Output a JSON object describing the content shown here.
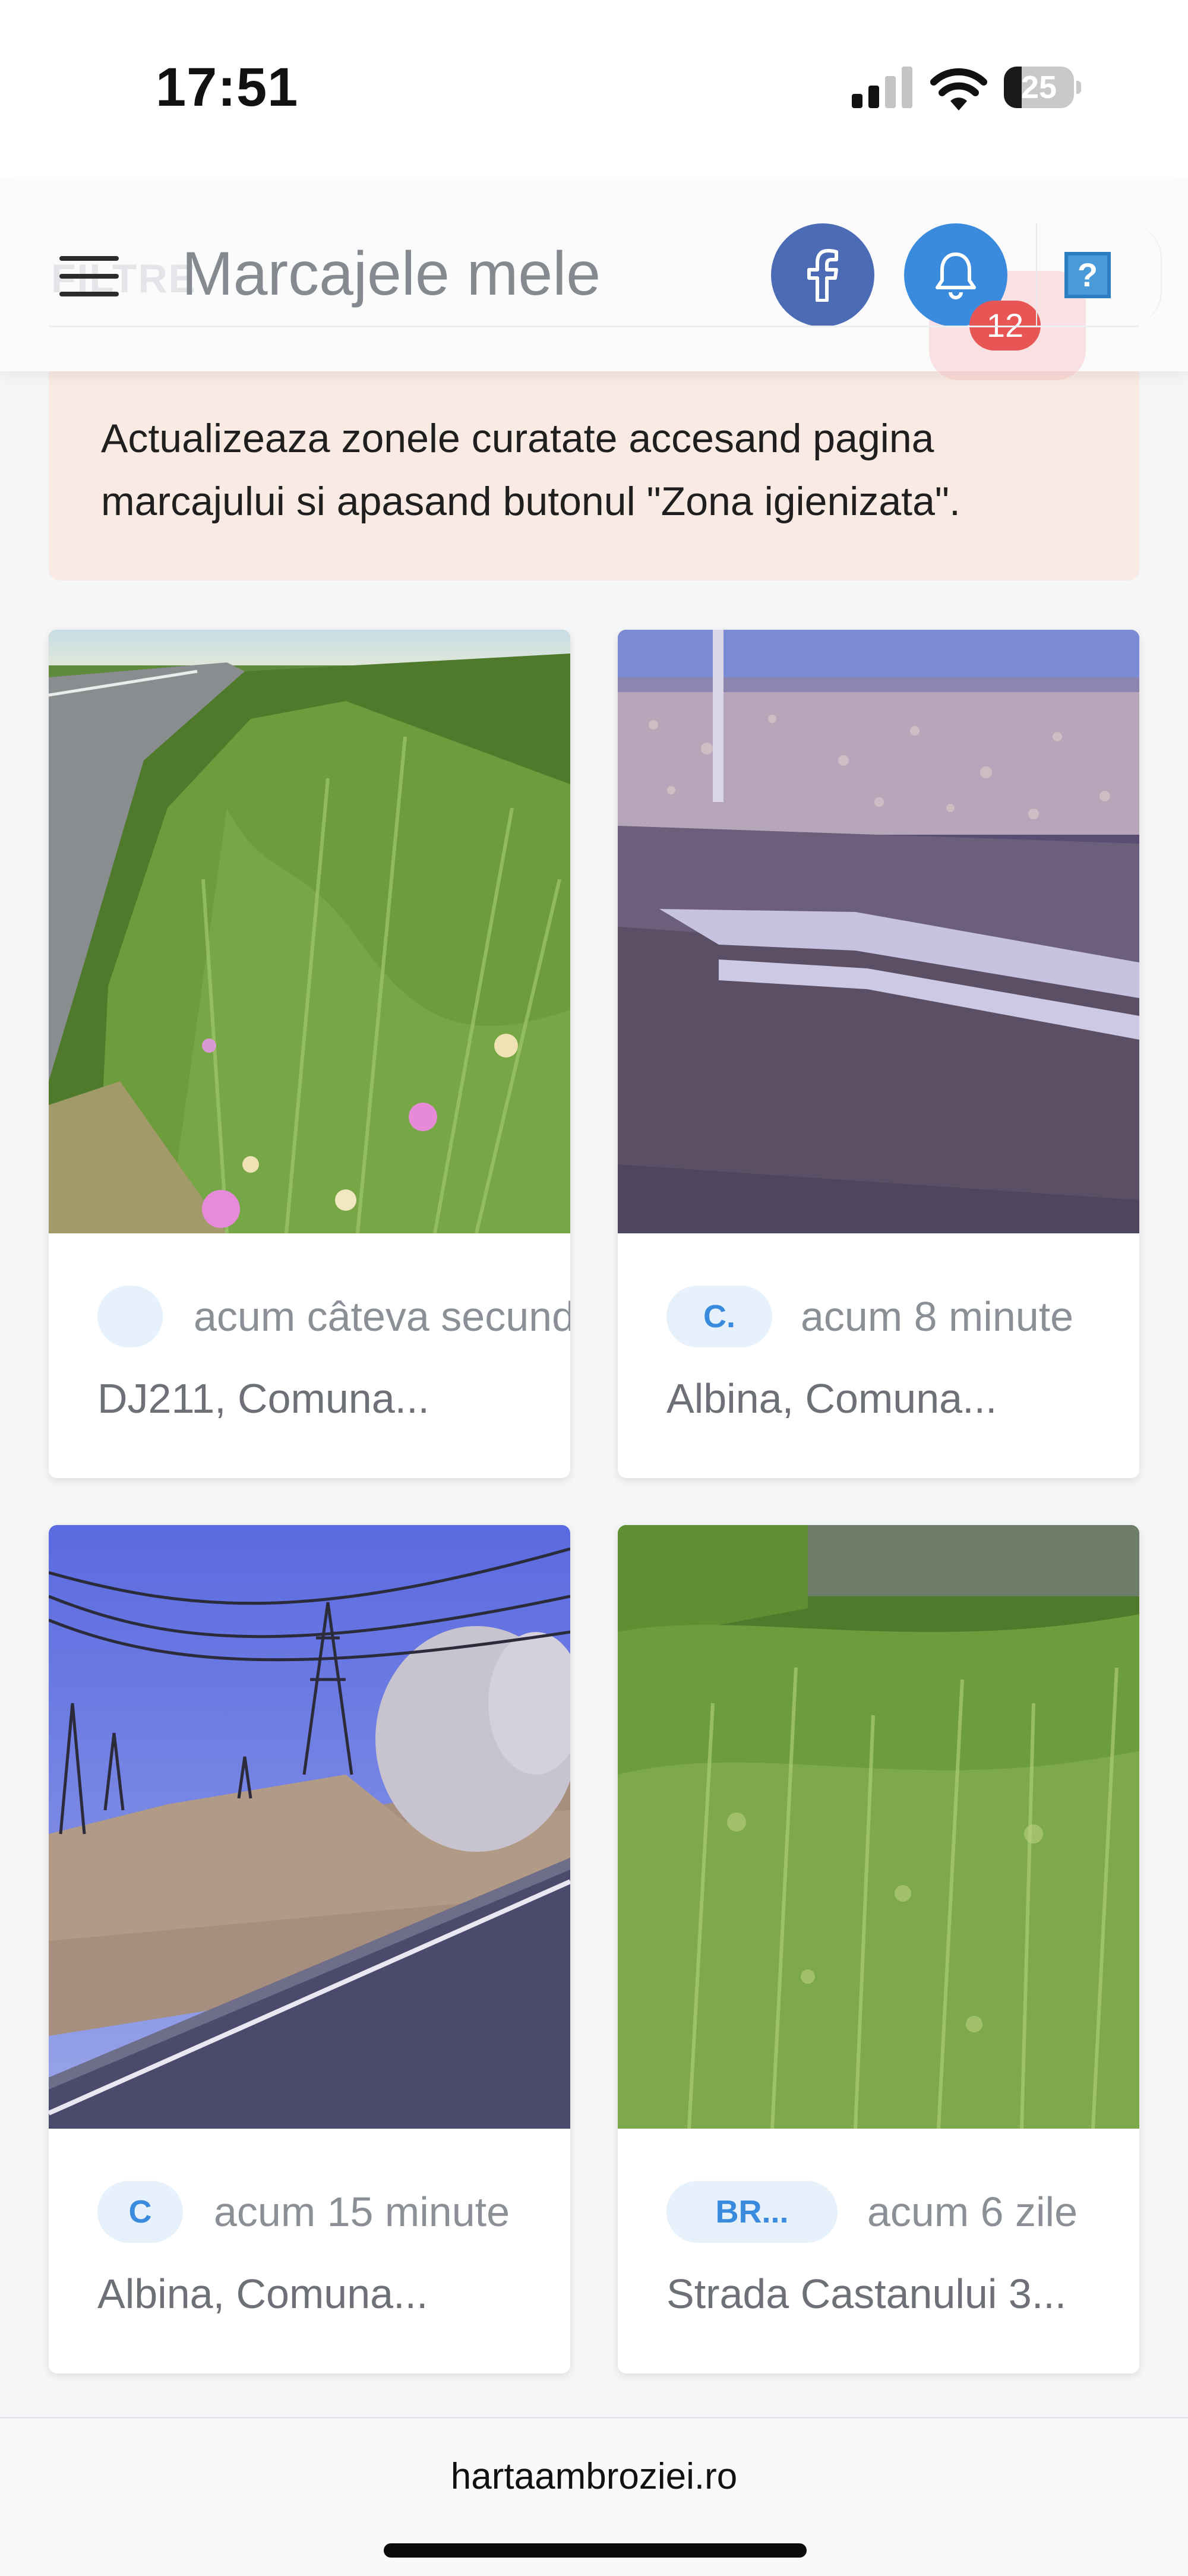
{
  "status_bar": {
    "time": "17:51",
    "battery_level": "25",
    "battery_fraction": 0.25,
    "signal_bars_active": 2,
    "signal_bars_total": 4
  },
  "header": {
    "ghost_text": "FILTRE",
    "title": "Marcajele mele",
    "notification_count": "12",
    "help_label": "?"
  },
  "banner": {
    "text": "Actualizeaza zonele curatate accesand pagina marcajului si apasand butonul \"Zona igienizata\"."
  },
  "cards": [
    {
      "user": "",
      "time": "acum câteva secunde",
      "location": "DJ211, Comuna...",
      "photo": "roadside-weeds"
    },
    {
      "user": "C.",
      "time": "acum 8 minute",
      "location": "Albina, Comuna...",
      "photo": "field-guardrail"
    },
    {
      "user": "C",
      "time": "acum 15 minute",
      "location": "Albina, Comuna...",
      "photo": "powerlines-field"
    },
    {
      "user": "BR...",
      "time": "acum 6 zile",
      "location": "Strada Castanului 3...",
      "photo": "dense-weeds"
    }
  ],
  "footer": {
    "domain": "hartaambroziei.ro"
  },
  "colors": {
    "facebook": "#4c6bb5",
    "bell": "#3a8bde",
    "badge": "#e85555",
    "banner_bg": "#f9ebe3",
    "chip_bg": "#e6f1fb",
    "chip_text": "#3a8bde"
  },
  "icons": [
    "menu-icon",
    "facebook-icon",
    "bell-icon",
    "help-icon",
    "signal-icon",
    "wifi-icon",
    "battery-icon"
  ]
}
